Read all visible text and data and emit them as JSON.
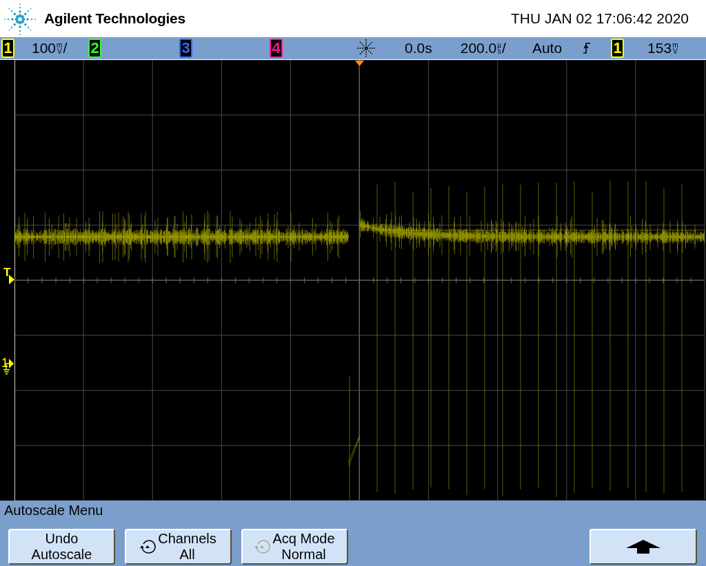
{
  "header": {
    "brand": "Agilent Technologies",
    "datetime": "THU JAN 02 17:06:42 2020"
  },
  "status_bar": {
    "channels": [
      {
        "number": "1",
        "color": "#ffff00",
        "scale": "100",
        "prefix": "m",
        "unit": "V",
        "suffix": "/"
      },
      {
        "number": "2",
        "color": "#33ff33"
      },
      {
        "number": "3",
        "color": "#3366ff"
      },
      {
        "number": "4",
        "color": "#ff1493"
      }
    ],
    "time_delay": "0.0s",
    "time_scale": "200.0",
    "time_prefix": "µ",
    "time_unit": "s",
    "time_suffix": "/",
    "trigger_mode": "Auto",
    "trigger_source": {
      "number": "1",
      "color": "#ffff00"
    },
    "trigger_level": "153",
    "trigger_prefix": "m",
    "trigger_unit": "V"
  },
  "display": {
    "trigger_marker": "T",
    "ground_marker": "1"
  },
  "softkey_menu": {
    "title": "Autoscale Menu",
    "keys": [
      {
        "kind": "text",
        "lines": [
          "Undo",
          "Autoscale"
        ]
      },
      {
        "kind": "cycle",
        "icon_enabled": true,
        "lines": [
          "Channels",
          "All"
        ]
      },
      {
        "kind": "cycle",
        "icon_enabled": false,
        "lines": [
          "Acq Mode",
          "Normal"
        ]
      },
      {
        "kind": "empty"
      },
      {
        "kind": "empty"
      },
      {
        "kind": "back"
      }
    ]
  }
}
